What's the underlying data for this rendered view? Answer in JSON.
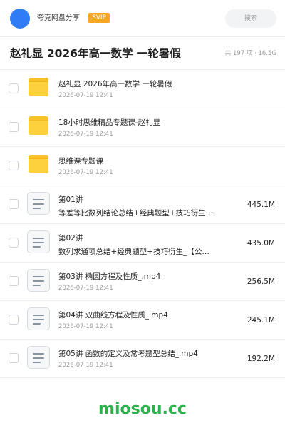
{
  "header": {
    "app_name": "夸克网盘分享",
    "badge": "SVIP",
    "search_placeholder": "搜索"
  },
  "folder": {
    "title": "赵礼显 2026年高一数学 一轮暑假",
    "summary": "共 197 项 · 16.5G"
  },
  "items": [
    {
      "type": "folder",
      "name": "赵礼显 2026年高一数学 一轮暑假",
      "date": "2026-07-19 12:41",
      "size": ""
    },
    {
      "type": "folder",
      "name": "18小时思维精品专题课-赵礼显",
      "date": "2026-07-19 12:41",
      "size": ""
    },
    {
      "type": "folder",
      "name": "思维课专题课",
      "date": "2026-07-19 12:41",
      "size": ""
    },
    {
      "type": "file",
      "name": "第01讲",
      "desc": "等差等比数列结论总结+经典题型+技巧衍生…",
      "size": "445.1M"
    },
    {
      "type": "file",
      "name": "第02讲",
      "desc": "数列求通项总结+经典题型+技巧衍生_【公…",
      "size": "435.0M"
    },
    {
      "type": "file",
      "name": "第03讲 椭圆方程及性质_.mp4",
      "date": "2026-07-19 12:41",
      "size": "256.5M"
    },
    {
      "type": "file",
      "name": "第04讲 双曲线方程及性质_.mp4",
      "date": "2026-07-19 12:41",
      "size": "245.1M"
    },
    {
      "type": "file",
      "name": "第05讲 函数的定义及常考题型总结_.mp4",
      "date": "2026-07-19 12:41",
      "size": "192.2M"
    }
  ],
  "watermark": "miosou.cc"
}
